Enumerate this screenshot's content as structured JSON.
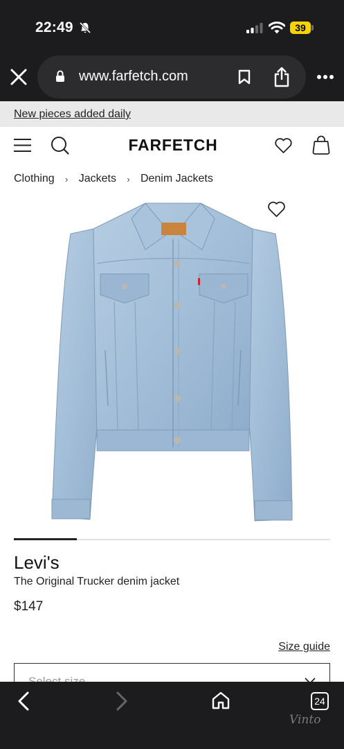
{
  "status_bar": {
    "time": "22:49",
    "battery": "39"
  },
  "browser": {
    "url": "www.farfetch.com",
    "tab_count": "24",
    "icons": [
      "close-icon",
      "lock-icon",
      "bookmark-icon",
      "share-icon",
      "more-icon",
      "back-icon",
      "forward-icon",
      "home-icon"
    ]
  },
  "banner": {
    "text": "New pieces added daily"
  },
  "header": {
    "logo": "FARFETCH",
    "icons": [
      "menu-icon",
      "search-icon",
      "wishlist-icon",
      "bag-icon"
    ]
  },
  "breadcrumb": {
    "items": [
      "Clothing",
      "Jackets",
      "Denim Jackets"
    ],
    "separator": "›"
  },
  "product": {
    "brand": "Levi's",
    "name": "The Original Trucker denim jacket",
    "price": "$147",
    "image_index": 1,
    "image_count": 5
  },
  "size": {
    "guide_label": "Size guide",
    "placeholder": "Select size"
  },
  "watermark": "Vinto",
  "colors": {
    "chrome": "#1c1c1e",
    "battery": "#f5d400",
    "denim": "#a9c3db",
    "banner": "#e9e9e9"
  }
}
